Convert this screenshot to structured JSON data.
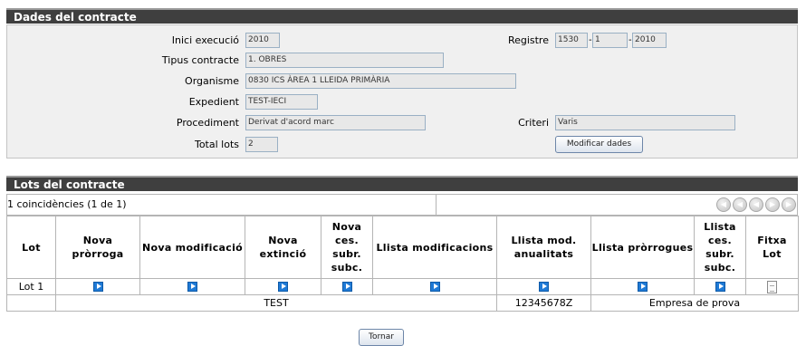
{
  "dades": {
    "title": "Dades del contracte",
    "inici_label": "Inici execució",
    "inici_value": "2010",
    "registre_label": "Registre",
    "registre_1": "1530",
    "registre_2": "1",
    "registre_3": "2010",
    "tipus_label": "Tipus contracte",
    "tipus_value": "1. OBRES",
    "organisme_label": "Organisme",
    "organisme_value": "0830 ICS ÀREA 1 LLEIDA PRIMÀRIA",
    "expedient_label": "Expedient",
    "expedient_value": "TEST-IECI",
    "procediment_label": "Procediment",
    "procediment_value": "Derivat d'acord marc",
    "criteri_label": "Criteri",
    "criteri_value": "Varis",
    "total_label": "Total lots",
    "total_value": "2",
    "modify_button": "Modificar dades"
  },
  "lots": {
    "title": "Lots del contracte",
    "count_text": "1 coincidències (1 de 1)",
    "headers": [
      "Lot",
      "Nova pròrroga",
      "Nova modificació",
      "Nova extinció",
      "Nova ces. subr. subc.",
      "Llista modificacions",
      "Llista mod. anualitats",
      "Llista pròrrogues",
      "Llista ces. subr. subc.",
      "Fitxa Lot"
    ],
    "row": {
      "lot": "Lot 1",
      "name": "TEST",
      "nif": "12345678Z",
      "company": "Empresa de prova"
    },
    "nav_icons": [
      "first-page-icon",
      "previous-page-icon",
      "previous-icon",
      "next-icon",
      "last-page-icon"
    ]
  },
  "footer": {
    "back_button": "Tornar"
  },
  "colors": {
    "header_bg": "#3f3f3f",
    "form_bg": "#f0f0f0",
    "play_icon": "#1f7ad6"
  }
}
